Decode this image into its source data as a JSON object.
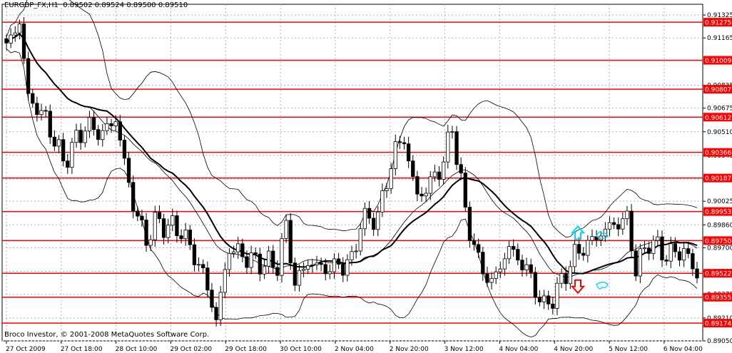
{
  "chart_data": {
    "type": "candlestick",
    "header": {
      "symbol": "EURGBP_FX,H1",
      "values": "0.89502 0.89524 0.89500 0.89510"
    },
    "footer": "Broco Investor, © 2001-2008 MetaQuotes Software Corp.",
    "ylim": [
      0.8905,
      0.914
    ],
    "price_ticks": [
      "0.91325",
      "0.91165",
      "0.90835",
      "0.90675",
      "0.90510",
      "0.90345",
      "0.90180",
      "0.90025",
      "0.89860",
      "0.89700",
      "0.89535",
      "0.89375",
      "0.89210",
      "0.89050"
    ],
    "level_lines": [
      "0.91275",
      "0.91009",
      "0.90807",
      "0.90612",
      "0.90366",
      "0.90187",
      "0.89953",
      "0.89750",
      "0.89522",
      "0.89355",
      "0.89174"
    ],
    "time_labels": [
      "27 Oct 2009",
      "27 Oct 18:00",
      "28 Oct 10:00",
      "29 Oct 02:00",
      "29 Oct 18:00",
      "30 Oct 10:00",
      "2 Nov 04:00",
      "2 Nov 20:00",
      "3 Nov 12:00",
      "4 Nov 04:00",
      "4 Nov 20:00",
      "5 Nov 12:00",
      "6 Nov 04:00"
    ],
    "anchors": [
      {
        "t": 0,
        "p": 0.911
      },
      {
        "t": 3,
        "p": 0.9128
      },
      {
        "t": 5,
        "p": 0.9075
      },
      {
        "t": 9,
        "p": 0.906
      },
      {
        "t": 13,
        "p": 0.903
      },
      {
        "t": 18,
        "p": 0.9055
      },
      {
        "t": 22,
        "p": 0.905
      },
      {
        "t": 25,
        "p": 0.906
      },
      {
        "t": 29,
        "p": 0.9
      },
      {
        "t": 32,
        "p": 0.8975
      },
      {
        "t": 34,
        "p": 0.8988
      },
      {
        "t": 40,
        "p": 0.8982
      },
      {
        "t": 45,
        "p": 0.8952
      },
      {
        "t": 48,
        "p": 0.892
      },
      {
        "t": 51,
        "p": 0.897
      },
      {
        "t": 57,
        "p": 0.896
      },
      {
        "t": 62,
        "p": 0.8958
      },
      {
        "t": 64,
        "p": 0.8985
      },
      {
        "t": 66,
        "p": 0.8945
      },
      {
        "t": 69,
        "p": 0.896
      },
      {
        "t": 73,
        "p": 0.8955
      },
      {
        "t": 79,
        "p": 0.896
      },
      {
        "t": 81,
        "p": 0.8988
      },
      {
        "t": 85,
        "p": 0.8992
      },
      {
        "t": 89,
        "p": 0.904
      },
      {
        "t": 91,
        "p": 0.9045
      },
      {
        "t": 94,
        "p": 0.9005
      },
      {
        "t": 97,
        "p": 0.9015
      },
      {
        "t": 100,
        "p": 0.903
      },
      {
        "t": 102,
        "p": 0.9055
      },
      {
        "t": 105,
        "p": 0.8995
      },
      {
        "t": 108,
        "p": 0.896
      },
      {
        "t": 111,
        "p": 0.8945
      },
      {
        "t": 115,
        "p": 0.897
      },
      {
        "t": 119,
        "p": 0.8955
      },
      {
        "t": 123,
        "p": 0.8928
      },
      {
        "t": 126,
        "p": 0.894
      },
      {
        "t": 130,
        "p": 0.8965
      },
      {
        "t": 134,
        "p": 0.8975
      },
      {
        "t": 138,
        "p": 0.8985
      },
      {
        "t": 142,
        "p": 0.899
      },
      {
        "t": 144,
        "p": 0.8955
      },
      {
        "t": 147,
        "p": 0.8975
      },
      {
        "t": 151,
        "p": 0.8965
      },
      {
        "t": 155,
        "p": 0.8968
      },
      {
        "t": 158,
        "p": 0.8951
      }
    ],
    "candle_count": 159,
    "ma_period": 24,
    "bb_period": 20,
    "bb_dev": 2,
    "grid": true,
    "signals": [
      {
        "name": "buy-arrow",
        "direction": "up",
        "color": "#00d8ff",
        "level": "0.89750"
      },
      {
        "name": "sell-arrow",
        "direction": "down",
        "color": "#ff0000",
        "level": "0.89355"
      }
    ],
    "colors": {
      "level_line": "#ff0000",
      "level_label_bg": "#ff0000",
      "level_label_text": "#ffffff",
      "candle": "#000000",
      "ma": "#000000",
      "bands": "#000000",
      "grid": "#b0b0b0",
      "signal_up": "#00d8ff",
      "signal_down": "#ff0000"
    }
  }
}
